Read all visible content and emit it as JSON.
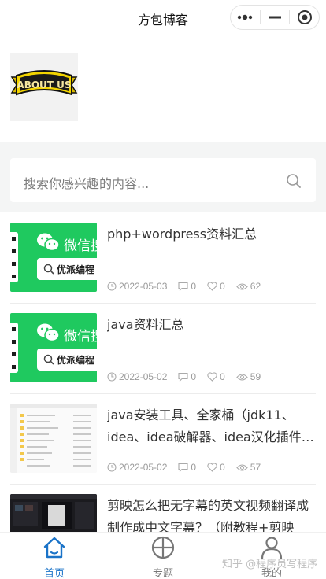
{
  "app": {
    "title": "方包博客"
  },
  "banner": {
    "logo_text": "ABOUT US"
  },
  "search": {
    "placeholder": "搜索你感兴趣的内容..."
  },
  "posts": [
    {
      "title": "php+wordpress资料汇总",
      "date": "2022-05-03",
      "comments": "0",
      "likes": "0",
      "views": "62",
      "thumb": "wechat",
      "thumb_text": "微信搜",
      "thumb_pill": "优派编程"
    },
    {
      "title": "java资料汇总",
      "date": "2022-05-02",
      "comments": "0",
      "likes": "0",
      "views": "59",
      "thumb": "wechat",
      "thumb_text": "微信搜",
      "thumb_pill": "优派编程"
    },
    {
      "title": "java安装工具、全家桶（jdk11、idea、idea破解器、idea汉化插件…",
      "date": "2022-05-02",
      "comments": "0",
      "likes": "0",
      "views": "57",
      "thumb": "file-explorer"
    },
    {
      "title": "剪映怎么把无字幕的英文视频翻译成制作成中文字幕？（附教程+剪映字…",
      "thumb": "video-editor"
    }
  ],
  "tabbar": {
    "items": [
      {
        "label": "首页",
        "active": true
      },
      {
        "label": "专题",
        "active": false
      },
      {
        "label": "我的",
        "active": false
      }
    ]
  },
  "watermark": "知乎 @程序员写程序",
  "colors": {
    "accent": "#1a73c8",
    "wechat_green": "#1fc95f",
    "page_bg": "#f4f5f5"
  }
}
